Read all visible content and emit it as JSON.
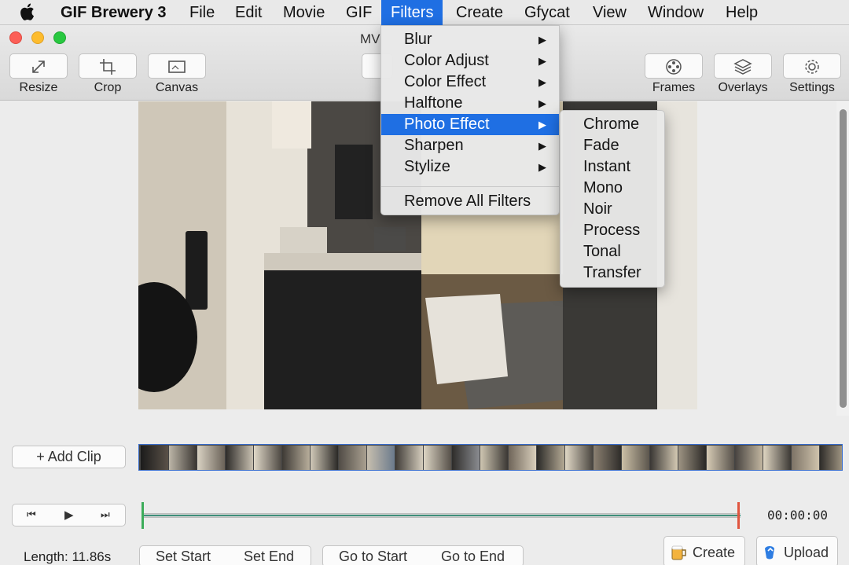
{
  "menubar": {
    "app": "GIF Brewery 3",
    "items": [
      "File",
      "Edit",
      "Movie",
      "GIF",
      "Filters",
      "Create",
      "Gfycat",
      "View",
      "Window",
      "Help"
    ],
    "active": "Filters"
  },
  "window": {
    "title": "MV",
    "toolbar_left": [
      {
        "label": "Resize",
        "icon": "resize-icon"
      },
      {
        "label": "Crop",
        "icon": "crop-icon"
      },
      {
        "label": "Canvas",
        "icon": "canvas-icon"
      }
    ],
    "toolbar_right": [
      {
        "label": "Frames",
        "icon": "film-reel-icon"
      },
      {
        "label": "Overlays",
        "icon": "layers-icon"
      },
      {
        "label": "Settings",
        "icon": "gear-icon"
      }
    ]
  },
  "filters_menu": {
    "items": [
      {
        "label": "Blur",
        "submenu": true
      },
      {
        "label": "Color Adjust",
        "submenu": true
      },
      {
        "label": "Color Effect",
        "submenu": true
      },
      {
        "label": "Halftone",
        "submenu": true
      },
      {
        "label": "Photo Effect",
        "submenu": true,
        "highlighted": true
      },
      {
        "label": "Sharpen",
        "submenu": true
      },
      {
        "label": "Stylize",
        "submenu": true
      }
    ],
    "remove_all": "Remove All Filters",
    "arrow": "▶"
  },
  "photo_effect_submenu": {
    "items": [
      "Chrome",
      "Fade",
      "Instant",
      "Mono",
      "Noir",
      "Process",
      "Tonal",
      "Transfer"
    ]
  },
  "clip": {
    "add_clip": "+ Add Clip"
  },
  "playback": {
    "timecode": "00:00:00",
    "length": "Length: 11.86s",
    "buttons": [
      "Set Start",
      "Set End",
      "Go to Start",
      "Go to End"
    ]
  },
  "actions": {
    "create": "Create",
    "upload": "Upload"
  },
  "colors": {
    "accent": "#1f6fe3",
    "start_marker": "#3dac5a",
    "end_marker": "#e0553f",
    "close": "#fc5f57",
    "minimize": "#fdbc2e",
    "zoom": "#28c840"
  }
}
